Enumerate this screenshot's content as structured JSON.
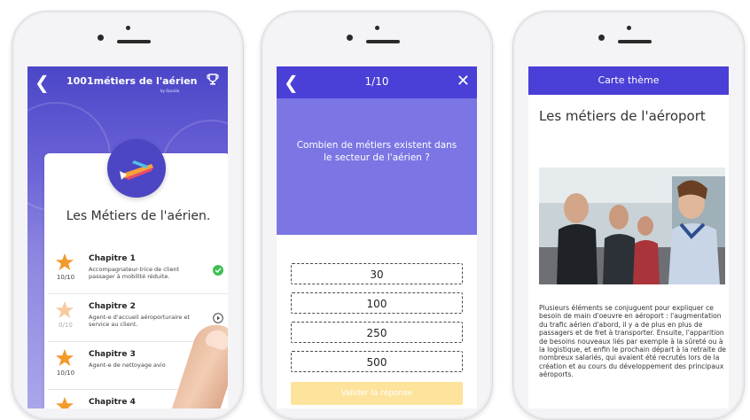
{
  "phone1": {
    "logo_text": "1001métiers de l'aérien",
    "logo_sub": "by Opcalia",
    "card_title": "Les Métiers de l'aérien.",
    "chapters": [
      {
        "title": "Chapitre 1",
        "desc": "Accompagnateur-trice de client passager à mobilité réduite.",
        "score": "10/10",
        "status": "completed"
      },
      {
        "title": "Chapitre 2",
        "desc": "Agent-e d'accueil aéroporturaire et service au client.",
        "score": "0/10",
        "status": "play"
      },
      {
        "title": "Chapitre 3",
        "desc": "Agent-e de nettoyage avio",
        "score": "10/10",
        "status": "completed"
      },
      {
        "title": "Chapitre 4",
        "desc": "",
        "score": "",
        "status": "play"
      }
    ],
    "colors": {
      "header": "#4b46c8",
      "star": "#f39a2c",
      "star_light": "#f7caa0",
      "check": "#3fbf56"
    }
  },
  "phone2": {
    "counter": "1/10",
    "question": "Combien de métiers existent dans le secteur de l'aérien ?",
    "answers": [
      "30",
      "100",
      "250",
      "500"
    ],
    "validate_label": "Valider la réponse",
    "colors": {
      "header": "#4a3fd6",
      "question_bg": "#7b76e4",
      "validate": "#fde39c"
    }
  },
  "phone3": {
    "header": "Carte thème",
    "heading": "Les métiers de l'aéroport",
    "body": "Plusieurs éléments se conjuguent pour expliquer ce besoin de main d'oeuvre en aéroport : l'augmentation du trafic aérien d'abord, il y a de plus en plus de passagers et de fret à transporter. Ensuite, l'apparition de besoins nouveaux liés par exemple à la sûreté ou à la logistique, et enfin le prochain départ à la retraite de nombreux salariés, qui avaient été recrutés lors de la création et au cours du développement des principaux aéroports."
  }
}
